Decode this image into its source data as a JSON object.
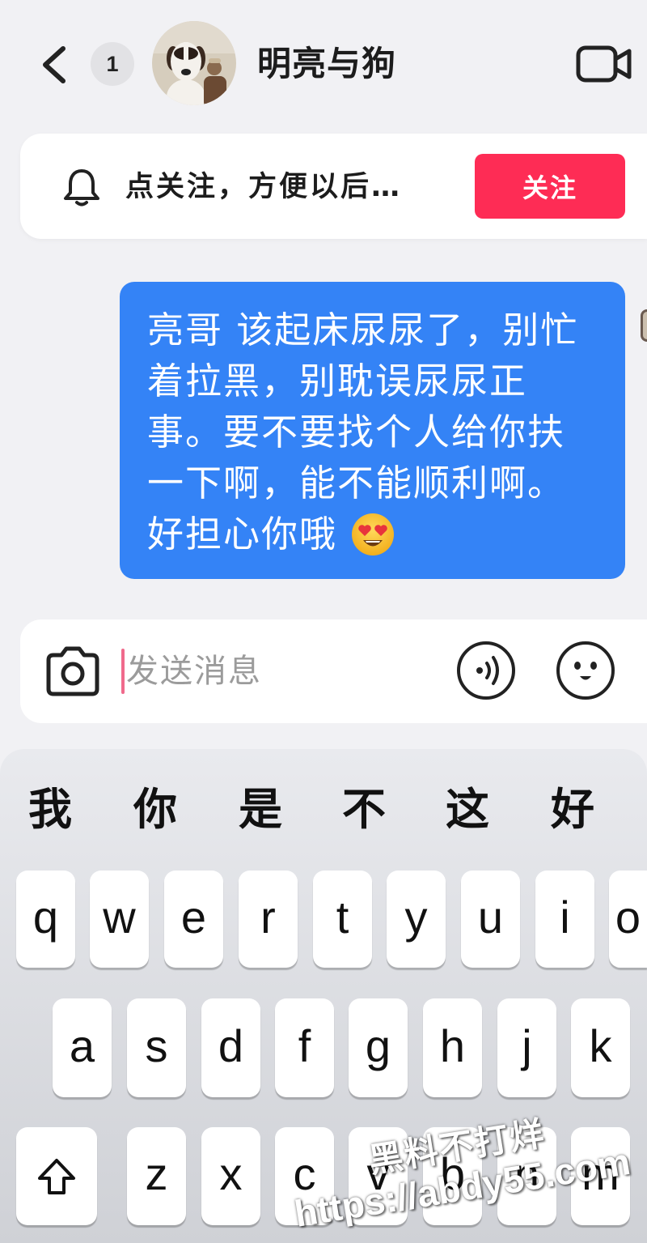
{
  "header": {
    "back_icon": "chevron-left-icon",
    "unread_count": "1",
    "contact_name": "明亮与狗",
    "video_call_icon": "video-camera-icon"
  },
  "follow_banner": {
    "bell_icon": "bell-icon",
    "text": "点关注，方便以后…",
    "button_label": "关注"
  },
  "messages": [
    {
      "lines": [
        "亮哥 该起床尿尿了，别忙",
        "着拉黑，别耽误尿尿正",
        "事。要不要找个人给你扶",
        "一下啊，能不能顺利啊。",
        "好担心你哦"
      ],
      "trailing_emoji_icon": "heart-eyes-emoji-icon"
    }
  ],
  "composer": {
    "camera_icon": "camera-icon",
    "placeholder": "发送消息",
    "voice_icon": "voice-message-icon",
    "emoji_icon": "emoji-face-icon"
  },
  "keyboard": {
    "candidates": [
      "我",
      "你",
      "是",
      "不",
      "这",
      "好"
    ],
    "rows": [
      [
        "q",
        "w",
        "e",
        "r",
        "t",
        "y",
        "u",
        "i",
        "o"
      ],
      [
        "a",
        "s",
        "d",
        "f",
        "g",
        "h",
        "j",
        "k"
      ],
      [
        "z",
        "x",
        "c",
        "v",
        "b",
        "n",
        "m"
      ]
    ],
    "shift_icon": "shift-arrow-icon"
  },
  "watermark": {
    "title": "黑料不打烊",
    "url": "https://abdy55.com"
  },
  "colors": {
    "accent": "#fe2c55",
    "bubble": "#3483f6",
    "background": "#f1f1f4"
  }
}
